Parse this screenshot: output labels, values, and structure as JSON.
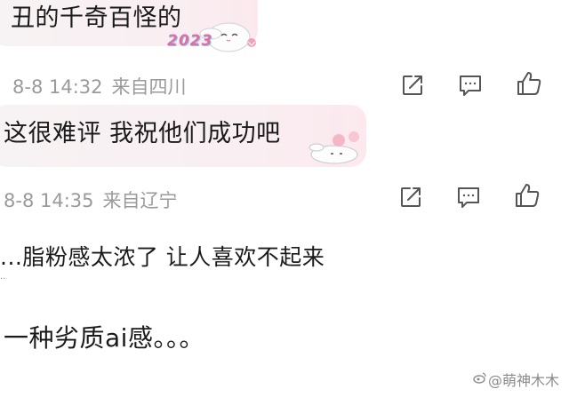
{
  "comments": [
    {
      "text": "丑的千奇百怪的",
      "sticker_badge": "2023",
      "time": "8-8 14:32",
      "location": "来自四川"
    },
    {
      "text": "这很难评 我祝他们成功吧",
      "time": "8-8 14:35",
      "location": "来自辽宁"
    }
  ],
  "posts": [
    {
      "text": "...脂粉感太浓了 让人喜欢不起来"
    },
    {
      "text": "一种劣质ai感。。。"
    }
  ],
  "stray_mark": "..",
  "watermark": "@萌神木木",
  "icons": [
    "share-icon",
    "comment-icon",
    "like-icon"
  ],
  "colors": {
    "meta": "#9a9a9a",
    "bubble": "#f7f0f2",
    "icon": "#555555",
    "badge": "#e86aa0"
  }
}
